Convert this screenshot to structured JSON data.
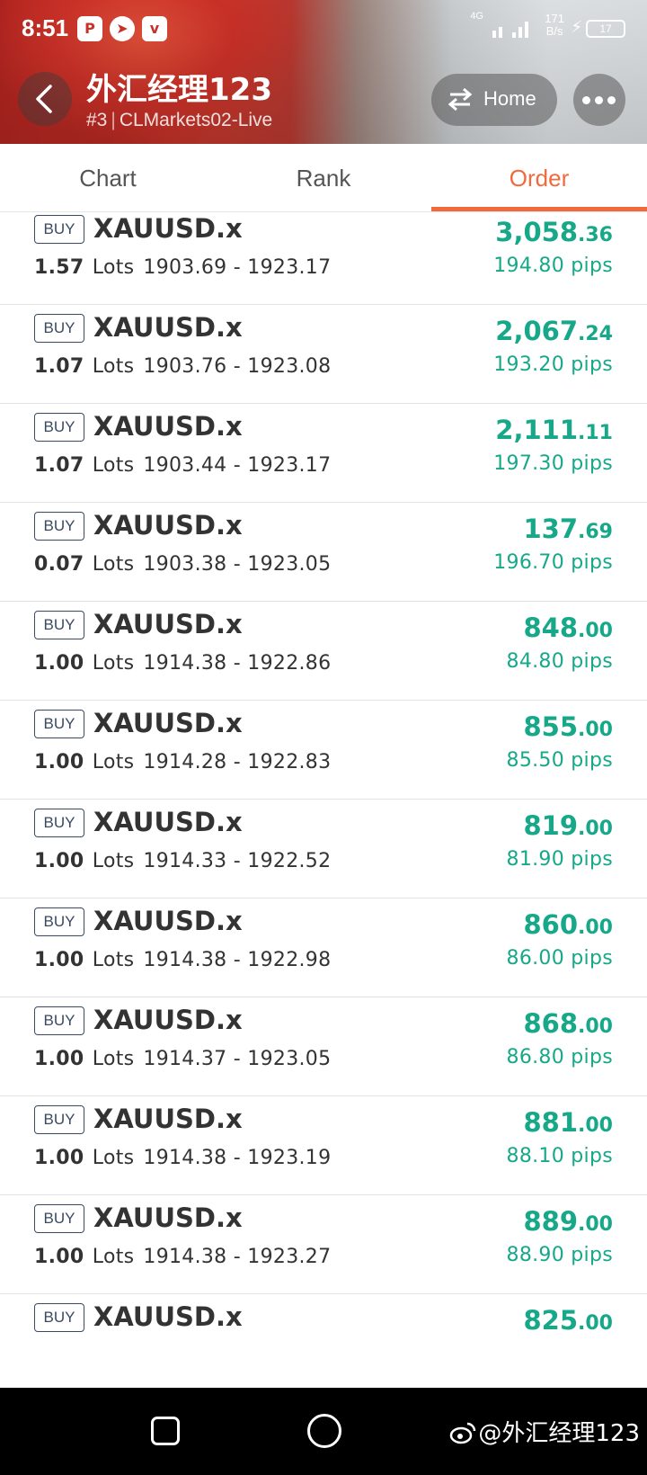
{
  "status_bar": {
    "time": "8:51",
    "network": "4G",
    "speed_value": "171",
    "speed_unit": "B/s",
    "battery": "17",
    "app_icons": [
      "notification-app-icon",
      "telegram-icon",
      "vivo-icon"
    ]
  },
  "header": {
    "title": "外汇经理123",
    "rank": "#3",
    "account": "CLMarkets02-Live",
    "home_label": "Home"
  },
  "tabs": [
    {
      "label": "Chart",
      "active": false
    },
    {
      "label": "Rank",
      "active": false
    },
    {
      "label": "Order",
      "active": true
    }
  ],
  "orders": [
    {
      "side": "BUY",
      "symbol": "XAUUSD.x",
      "lots": "1.57",
      "lots_word": "Lots",
      "range": "1903.69 - 1923.17",
      "profit_int": "3,058",
      "profit_dec": ".36",
      "pips": "194.80 pips"
    },
    {
      "side": "BUY",
      "symbol": "XAUUSD.x",
      "lots": "1.07",
      "lots_word": "Lots",
      "range": "1903.76 - 1923.08",
      "profit_int": "2,067",
      "profit_dec": ".24",
      "pips": "193.20 pips"
    },
    {
      "side": "BUY",
      "symbol": "XAUUSD.x",
      "lots": "1.07",
      "lots_word": "Lots",
      "range": "1903.44 - 1923.17",
      "profit_int": "2,111",
      "profit_dec": ".11",
      "pips": "197.30 pips"
    },
    {
      "side": "BUY",
      "symbol": "XAUUSD.x",
      "lots": "0.07",
      "lots_word": "Lots",
      "range": "1903.38 - 1923.05",
      "profit_int": "137",
      "profit_dec": ".69",
      "pips": "196.70 pips"
    },
    {
      "side": "BUY",
      "symbol": "XAUUSD.x",
      "lots": "1.00",
      "lots_word": "Lots",
      "range": "1914.38 - 1922.86",
      "profit_int": "848",
      "profit_dec": ".00",
      "pips": "84.80 pips"
    },
    {
      "side": "BUY",
      "symbol": "XAUUSD.x",
      "lots": "1.00",
      "lots_word": "Lots",
      "range": "1914.28 - 1922.83",
      "profit_int": "855",
      "profit_dec": ".00",
      "pips": "85.50 pips"
    },
    {
      "side": "BUY",
      "symbol": "XAUUSD.x",
      "lots": "1.00",
      "lots_word": "Lots",
      "range": "1914.33 - 1922.52",
      "profit_int": "819",
      "profit_dec": ".00",
      "pips": "81.90 pips"
    },
    {
      "side": "BUY",
      "symbol": "XAUUSD.x",
      "lots": "1.00",
      "lots_word": "Lots",
      "range": "1914.38 - 1922.98",
      "profit_int": "860",
      "profit_dec": ".00",
      "pips": "86.00 pips"
    },
    {
      "side": "BUY",
      "symbol": "XAUUSD.x",
      "lots": "1.00",
      "lots_word": "Lots",
      "range": "1914.37 - 1923.05",
      "profit_int": "868",
      "profit_dec": ".00",
      "pips": "86.80 pips"
    },
    {
      "side": "BUY",
      "symbol": "XAUUSD.x",
      "lots": "1.00",
      "lots_word": "Lots",
      "range": "1914.38 - 1923.19",
      "profit_int": "881",
      "profit_dec": ".00",
      "pips": "88.10 pips"
    },
    {
      "side": "BUY",
      "symbol": "XAUUSD.x",
      "lots": "1.00",
      "lots_word": "Lots",
      "range": "1914.38 - 1923.27",
      "profit_int": "889",
      "profit_dec": ".00",
      "pips": "88.90 pips"
    },
    {
      "side": "BUY",
      "symbol": "XAUUSD.x",
      "lots": "",
      "lots_word": "",
      "range": "",
      "profit_int": "825",
      "profit_dec": ".00",
      "pips": ""
    }
  ],
  "colors": {
    "accent": "#f26a3c",
    "profit": "#17a889",
    "badge": "#3a4a63"
  },
  "watermark": "@外汇经理123"
}
